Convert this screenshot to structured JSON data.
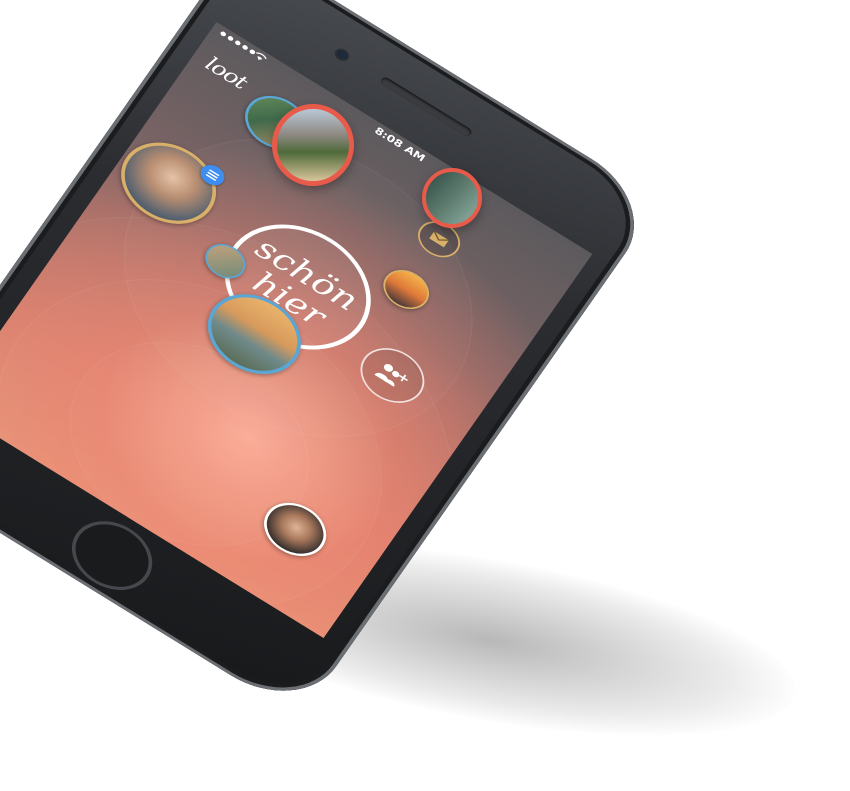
{
  "status_bar": {
    "time": "8:08 AM",
    "signal_dots": 5,
    "wifi_icon": "wifi-icon"
  },
  "app": {
    "logo_text": "loot",
    "center_logo_line1": "schön",
    "center_logo_line2": "hier"
  },
  "icons": {
    "mail": "mail-icon",
    "add_friend": "add-friends-icon",
    "menu_badge": "menu-icon"
  },
  "colors": {
    "accent_red": "#e85a4a",
    "accent_blue": "#5aa7d6",
    "accent_gold": "#d8b069",
    "badge_blue": "#3d8ef0"
  }
}
